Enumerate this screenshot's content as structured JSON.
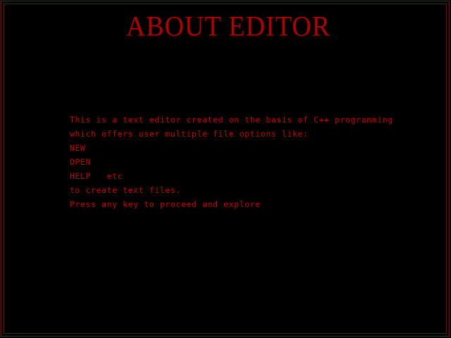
{
  "title": "ABOUT EDITOR",
  "lines": [
    "This is a text editor created on the basis of C++ programming",
    "which offers user multiple file options like:",
    "NEW",
    "OPEN",
    "HELP   etc",
    "to create text files.",
    "Press any key to proceed and explore"
  ],
  "colors": {
    "background": "#000000",
    "text": "#c80000",
    "border": "#9a0000"
  }
}
